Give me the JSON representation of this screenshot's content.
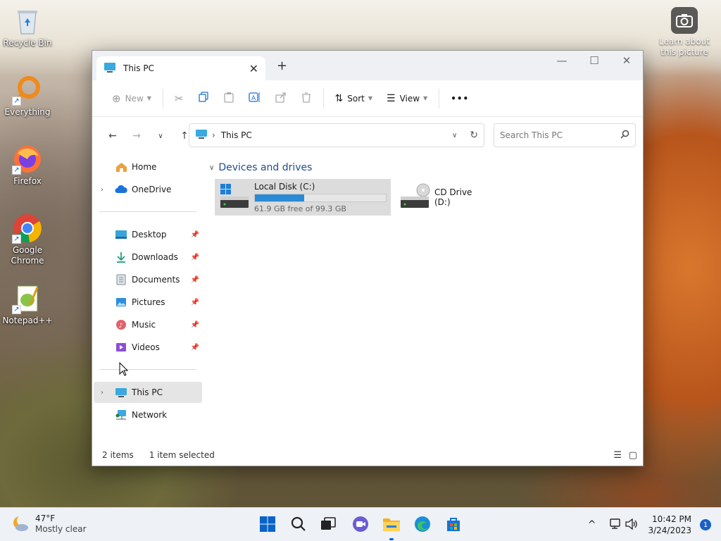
{
  "desktop": {
    "icons": [
      {
        "label": "Recycle Bin",
        "icon": "recycle-bin-icon"
      },
      {
        "label": "Everything",
        "icon": "everything-search-icon"
      },
      {
        "label": "Firefox",
        "icon": "firefox-icon"
      },
      {
        "label": "Google Chrome",
        "icon": "chrome-icon"
      },
      {
        "label": "Notepad++",
        "icon": "notepad-plus-plus-icon"
      }
    ],
    "learn_about": "Learn about this picture"
  },
  "explorer": {
    "tab_title": "This PC",
    "new_tab": "+",
    "window_controls": {
      "minimize": "—",
      "maximize": "☐",
      "close": "✕"
    },
    "toolbar": {
      "new_label": "New",
      "sort_label": "Sort",
      "view_label": "View",
      "more": "•••"
    },
    "address": "This PC",
    "search_placeholder": "Search This PC",
    "nav": {
      "home": "Home",
      "onedrive": "OneDrive",
      "quick_access": [
        {
          "label": "Desktop",
          "icon": "desktop-folder-icon"
        },
        {
          "label": "Downloads",
          "icon": "downloads-icon"
        },
        {
          "label": "Documents",
          "icon": "documents-icon"
        },
        {
          "label": "Pictures",
          "icon": "pictures-icon"
        },
        {
          "label": "Music",
          "icon": "music-icon"
        },
        {
          "label": "Videos",
          "icon": "videos-icon"
        }
      ],
      "this_pc": "This PC",
      "network": "Network"
    },
    "content": {
      "group_title": "Devices and drives",
      "drives": [
        {
          "name": "Local Disk (C:)",
          "free_text": "61.9 GB free of 99.3 GB",
          "used_fraction": 0.377,
          "selected": true
        },
        {
          "name": "CD Drive (D:)",
          "selected": false
        }
      ]
    },
    "status": {
      "items": "2 items",
      "selected": "1 item selected"
    }
  },
  "taskbar": {
    "weather": {
      "temp": "47°F",
      "condition": "Mostly clear"
    },
    "clock": {
      "time": "10:42 PM",
      "date": "3/24/2023"
    },
    "notification_count": "1",
    "tray_chevron": "^",
    "colors": {
      "accent": "#0a63c9"
    }
  }
}
